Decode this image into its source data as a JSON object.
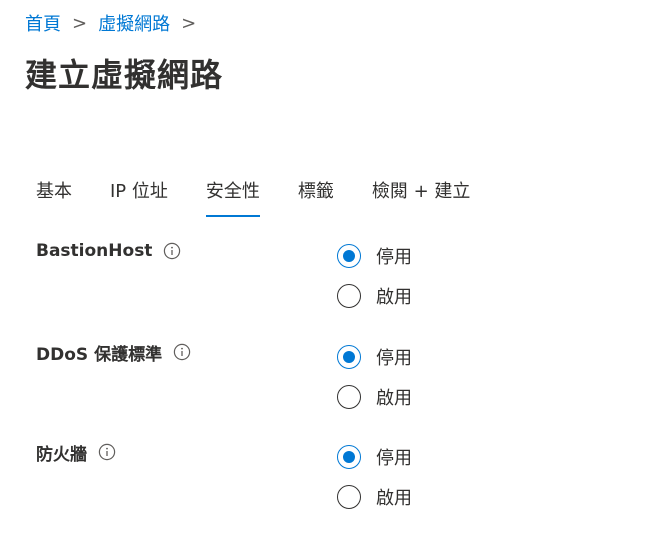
{
  "breadcrumb": {
    "items": [
      "首頁",
      "虛擬網路"
    ],
    "separator": ">"
  },
  "page": {
    "title": "建立虛擬網路"
  },
  "tabs": [
    {
      "label": "基本",
      "active": false
    },
    {
      "label": "IP 位址",
      "active": false
    },
    {
      "label": "安全性",
      "active": true
    },
    {
      "label": "標籤",
      "active": false
    },
    {
      "label": "檢閱 + 建立",
      "active": false
    }
  ],
  "settings": [
    {
      "label": "BastionHost",
      "info_icon": "info-icon",
      "options": [
        "停用",
        "啟用"
      ],
      "selected": "停用"
    },
    {
      "label": "DDoS 保護標準",
      "info_icon": "info-icon",
      "options": [
        "停用",
        "啟用"
      ],
      "selected": "停用"
    },
    {
      "label": "防火牆",
      "info_icon": "info-icon",
      "options": [
        "停用",
        "啟用"
      ],
      "selected": "停用"
    }
  ],
  "colors": {
    "accent": "#0078d4",
    "text": "#323130",
    "link": "#0078d4"
  }
}
